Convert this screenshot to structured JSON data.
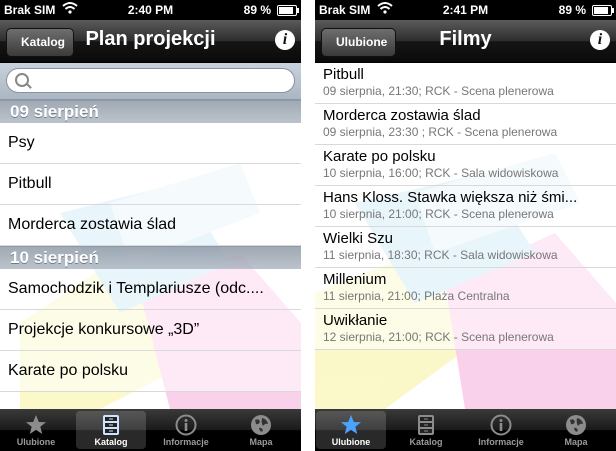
{
  "left": {
    "status": {
      "carrier": "Brak SIM",
      "time": "2:40 PM",
      "battery": "89 %",
      "battery_level": 0.89
    },
    "nav": {
      "back": "Katalog",
      "title": "Plan projekcji"
    },
    "search": {
      "placeholder": ""
    },
    "sections": [
      {
        "header": "09 sierpień",
        "items": [
          "Psy",
          "Pitbull",
          "Morderca zostawia ślad"
        ]
      },
      {
        "header": "10 sierpień",
        "items": [
          "Samochodzik i Templariusze  (odc....",
          "Projekcje konkursowe  „3D”",
          "Karate po polsku"
        ]
      }
    ]
  },
  "right": {
    "status": {
      "carrier": "Brak SIM",
      "time": "2:41 PM",
      "battery": "89 %",
      "battery_level": 0.89
    },
    "nav": {
      "back": "Ulubione",
      "title": "Filmy"
    },
    "films": [
      {
        "title": "Pitbull",
        "details": "09 sierpnia, 21:30; RCK - Scena plenerowa"
      },
      {
        "title": "Morderca zostawia ślad",
        "details": "09 sierpnia, 23:30 ; RCK - Scena plenerowa"
      },
      {
        "title": "Karate po polsku",
        "details": "10 sierpnia, 16:00; RCK - Sala widowiskowa"
      },
      {
        "title": "Hans Kloss. Stawka większa niż śmi...",
        "details": "10 sierpnia, 21:00; RCK - Scena plenerowa"
      },
      {
        "title": "Wielki Szu",
        "details": "11 sierpnia, 18:30; RCK - Sala widowiskowa"
      },
      {
        "title": "Millenium",
        "details": "11 sierpnia, 21:00; Plaża Centralna"
      },
      {
        "title": "Uwikłanie",
        "details": "12 sierpnia, 21:00; RCK - Scena plenerowa"
      }
    ]
  },
  "tabbar": {
    "tabs": [
      {
        "label": "Ulubione",
        "icon": "star-icon"
      },
      {
        "label": "Katalog",
        "icon": "file-cabinet-icon"
      },
      {
        "label": "Informacje",
        "icon": "info-icon"
      },
      {
        "label": "Mapa",
        "icon": "globe-icon"
      }
    ],
    "left_active": 1,
    "right_active": 0
  },
  "colors": {
    "tab_active_icon": "#4aa3ff",
    "section_header": "#a3acb7"
  }
}
